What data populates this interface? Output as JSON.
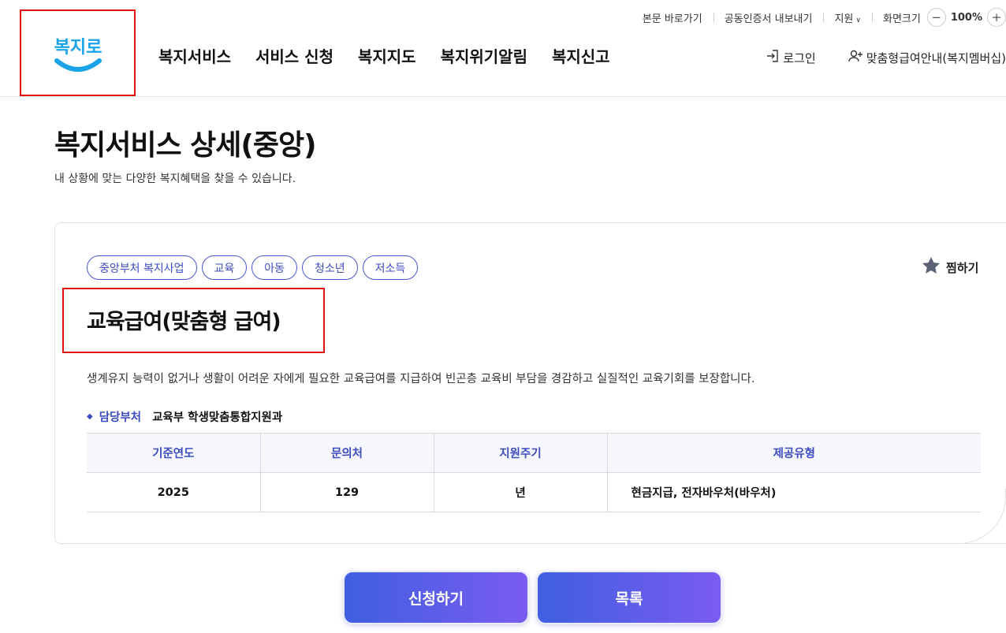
{
  "utility": {
    "skip_link": "본문 바로가기",
    "cert_export": "공동인증서 내보내기",
    "support": "지원",
    "zoom_label": "화면크기",
    "zoom_minus": "−",
    "zoom_value": "100%",
    "zoom_plus": "+"
  },
  "logo": {
    "text": "복지로",
    "color": "#1aa3e8"
  },
  "gnb": [
    {
      "label": "복지서비스"
    },
    {
      "label": "서비스 신청"
    },
    {
      "label": "복지지도"
    },
    {
      "label": "복지위기알림"
    },
    {
      "label": "복지신고"
    }
  ],
  "header_right": {
    "login": "로그인",
    "membership": "맞춤형급여안내(복지멤버십)"
  },
  "page": {
    "title": "복지서비스 상세(중앙)",
    "description": "내 상황에 맞는 다양한 복지혜택을 찾을 수 있습니다."
  },
  "service": {
    "tags": [
      "중앙부처 복지사업",
      "교육",
      "아동",
      "청소년",
      "저소득"
    ],
    "bookmark_label": "찜하기",
    "title": "교육급여(맞춤형 급여)",
    "description": "생계유지 능력이 없거나 생활이 어려운 자에게 필요한 교육급여를 지급하여 빈곤층 교육비 부담을 경감하고 실질적인 교육기회를 보장합니다.",
    "dept_label": "담당부처",
    "dept_value": "교육부 학생맞춤통합지원과",
    "table": {
      "headers": [
        "기준연도",
        "문의처",
        "지원주기",
        "제공유형"
      ],
      "row": [
        "2025",
        "129",
        "년",
        "현금지급, 전자바우처(바우처)"
      ]
    }
  },
  "buttons": {
    "apply": "신청하기",
    "list": "목록"
  },
  "colors": {
    "accent": "#3c4cc0",
    "highlight_border": "#e01010",
    "button_gradient_start": "#3f5fe0",
    "button_gradient_end": "#7a5cf0"
  }
}
